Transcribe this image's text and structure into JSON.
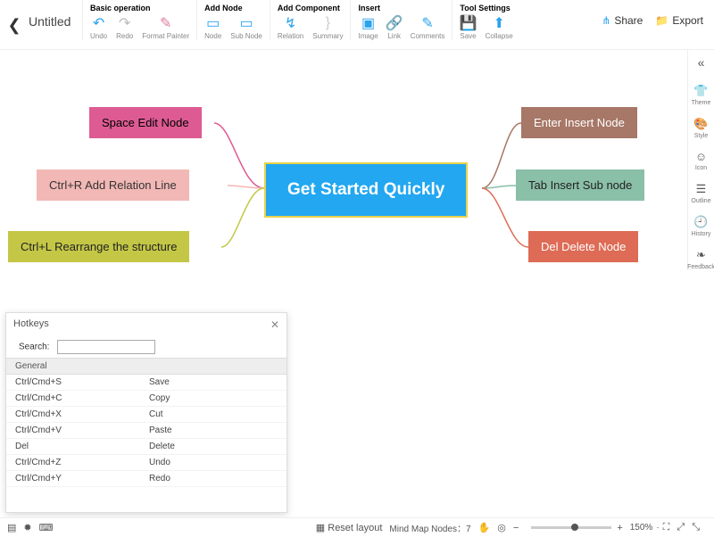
{
  "header": {
    "title": "Untitled",
    "groups": {
      "basic": {
        "title": "Basic operation",
        "undo": "Undo",
        "redo": "Redo",
        "format": "Format Painter"
      },
      "addNode": {
        "title": "Add Node",
        "node": "Node",
        "subnode": "Sub Node"
      },
      "addComp": {
        "title": "Add Component",
        "relation": "Relation",
        "summary": "Summary"
      },
      "insert": {
        "title": "Insert",
        "image": "Image",
        "link": "Link",
        "comments": "Comments"
      },
      "tool": {
        "title": "Tool Settings",
        "save": "Save",
        "collapse": "Collapse"
      }
    },
    "share": "Share",
    "export": "Export"
  },
  "sidebar": {
    "theme": "Theme",
    "style": "Style",
    "icon": "Icon",
    "outline": "Outline",
    "history": "History",
    "feedback": "Feedback"
  },
  "nodes": {
    "center": "Get Started Quickly",
    "l1": "Space Edit Node",
    "l2": "Ctrl+R Add Relation Line",
    "l3": "Ctrl+L Rearrange the structure",
    "r1": "Enter Insert Node",
    "r2": "Tab Insert Sub node",
    "r3": "Del Delete Node"
  },
  "panel": {
    "title": "Hotkeys",
    "searchLabel": "Search:",
    "category": "General",
    "rows": [
      {
        "k": "Ctrl/Cmd+S",
        "a": "Save"
      },
      {
        "k": "Ctrl/Cmd+C",
        "a": "Copy"
      },
      {
        "k": "Ctrl/Cmd+X",
        "a": "Cut"
      },
      {
        "k": "Ctrl/Cmd+V",
        "a": "Paste"
      },
      {
        "k": "Del",
        "a": "Delete"
      },
      {
        "k": "Ctrl/Cmd+Z",
        "a": "Undo"
      },
      {
        "k": "Ctrl/Cmd+Y",
        "a": "Redo"
      }
    ]
  },
  "bottom": {
    "reset": "Reset layout",
    "nodesLabel": "Mind Map Nodes：",
    "nodesCount": "7",
    "zoom": "150%"
  }
}
